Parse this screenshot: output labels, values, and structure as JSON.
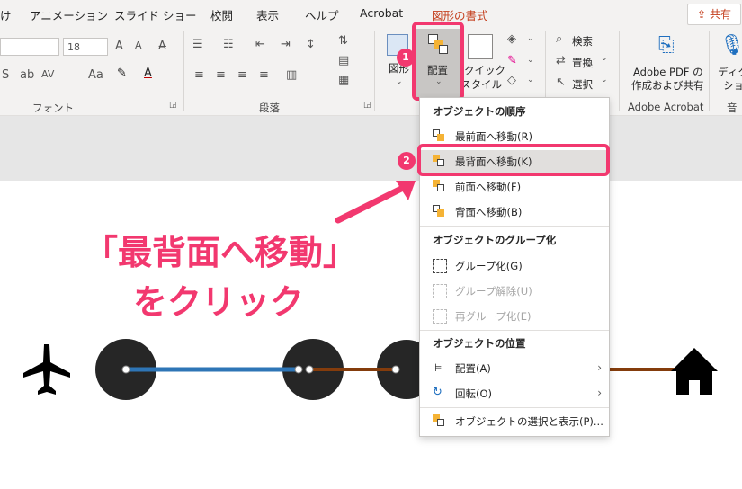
{
  "tabs": [
    "アニメーション",
    "スライド ショー",
    "校閲",
    "表示",
    "ヘルプ",
    "Acrobat",
    "図形の書式"
  ],
  "tab_partial": "け",
  "share_label": "共有",
  "ribbon": {
    "font_size": "18",
    "group_font": "フォント",
    "group_paragraph": "段落",
    "arrange_label": "配置",
    "quick_style_line1": "クイック",
    "quick_style_line2": "スタイル",
    "find": "検索",
    "replace": "置換",
    "select": "選択",
    "adobe_line1": "Adobe PDF の",
    "adobe_line2": "作成および共有",
    "group_adobe": "Adobe Acrobat",
    "dictation_line1": "ディクテ",
    "dictation_line2": "ション",
    "group_voice": "音声",
    "partial_fig": "図形"
  },
  "badges": [
    "1",
    "2"
  ],
  "menu": {
    "order_header": "オブジェクトの順序",
    "bring_front_most": "最前面へ移動(R)",
    "send_back_most": "最背面へ移動(K)",
    "bring_forward": "前面へ移動(F)",
    "send_backward": "背面へ移動(B)",
    "group_header": "オブジェクトのグループ化",
    "group": "グループ化(G)",
    "ungroup": "グループ解除(U)",
    "regroup": "再グループ化(E)",
    "position_header": "オブジェクトの位置",
    "align": "配置(A)",
    "rotate": "回転(O)",
    "selection_pane": "オブジェクトの選択と表示(P)..."
  },
  "callout": {
    "line1": "「最背面へ移動」",
    "line2": "をクリック"
  },
  "colors": {
    "accent": "#f2386f",
    "route_blue": "#2e75b6",
    "route_brown": "#843c0c",
    "circle": "#262626",
    "contextual_tab": "#c43e1c"
  },
  "icons": [
    "airplane-icon",
    "house-icon",
    "arrange-icon",
    "share-icon",
    "search-icon"
  ]
}
